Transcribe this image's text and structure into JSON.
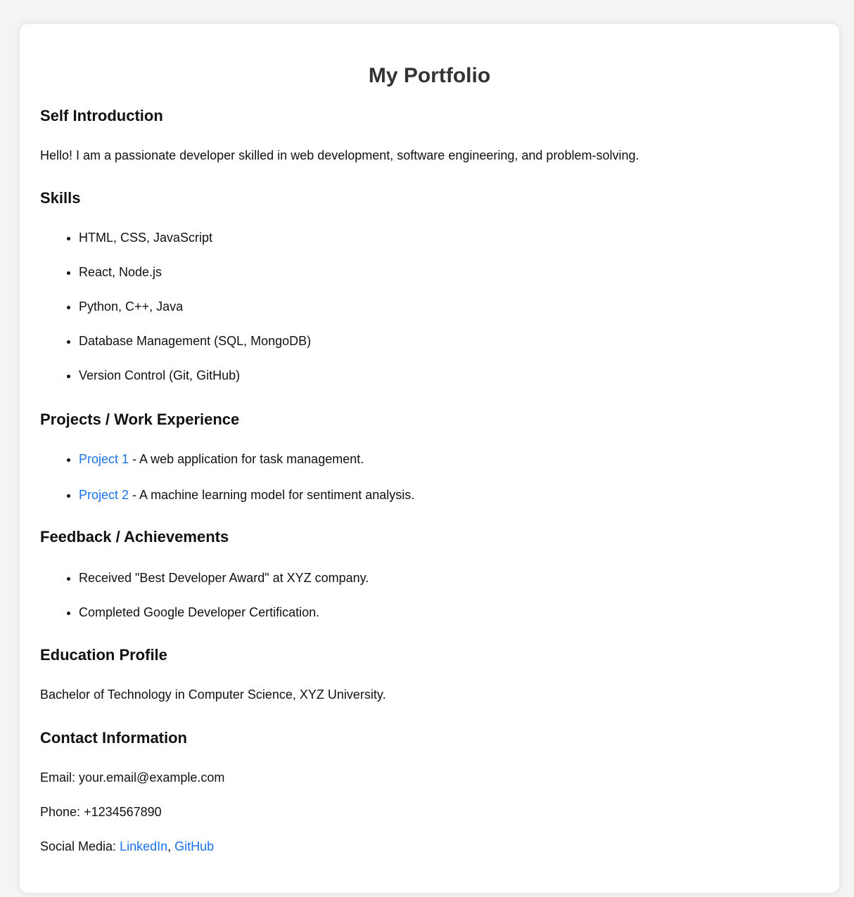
{
  "page": {
    "title": "My Portfolio"
  },
  "intro": {
    "heading": "Self Introduction",
    "text": "Hello! I am a passionate developer skilled in web development, software engineering, and problem-solving."
  },
  "skills": {
    "heading": "Skills",
    "items": [
      "HTML, CSS, JavaScript",
      "React, Node.js",
      "Python, C++, Java",
      "Database Management (SQL, MongoDB)",
      "Version Control (Git, GitHub)"
    ]
  },
  "projects": {
    "heading": "Projects / Work Experience",
    "items": [
      {
        "link": "Project 1",
        "desc": " - A web application for task management."
      },
      {
        "link": "Project 2",
        "desc": " - A machine learning model for sentiment analysis."
      }
    ]
  },
  "feedback": {
    "heading": "Feedback / Achievements",
    "items": [
      "Received \"Best Developer Award\" at XYZ company.",
      "Completed Google Developer Certification."
    ]
  },
  "education": {
    "heading": "Education Profile",
    "text": "Bachelor of Technology in Computer Science, XYZ University."
  },
  "contact": {
    "heading": "Contact Information",
    "email_label": "Email: ",
    "email": "your.email@example.com",
    "phone_label": "Phone: ",
    "phone": "+1234567890",
    "social_label": "Social Media: ",
    "linkedin": "LinkedIn",
    "separator": ", ",
    "github": "GitHub"
  },
  "colors": {
    "link": "#1a73e8",
    "title": "#333333",
    "page_background": "#f4f4f4",
    "card_background": "#ffffff"
  }
}
